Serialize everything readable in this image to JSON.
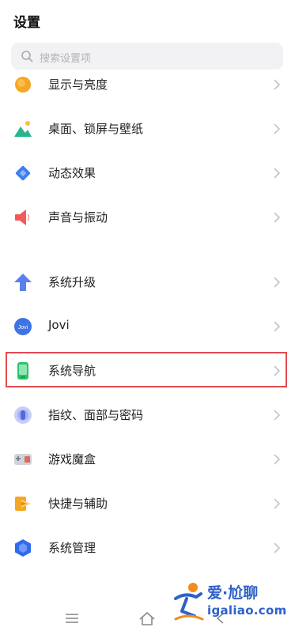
{
  "header": {
    "title": "设置"
  },
  "search": {
    "placeholder": "搜索设置项",
    "icon": "search-icon"
  },
  "items": [
    {
      "label": "显示与亮度",
      "icon": "display-brightness-icon"
    },
    {
      "label": "桌面、锁屏与壁纸",
      "icon": "wallpaper-icon"
    },
    {
      "label": "动态效果",
      "icon": "animation-effects-icon"
    },
    {
      "label": "声音与振动",
      "icon": "sound-vibration-icon"
    },
    {
      "label": "系统升级",
      "icon": "system-update-icon"
    },
    {
      "label": "Jovi",
      "icon": "jovi-icon",
      "icon_text": "Jovi"
    },
    {
      "label": "系统导航",
      "icon": "system-navigation-icon",
      "highlighted": true
    },
    {
      "label": "指纹、面部与密码",
      "icon": "fingerprint-icon"
    },
    {
      "label": "游戏魔盒",
      "icon": "game-box-icon"
    },
    {
      "label": "快捷与辅助",
      "icon": "shortcuts-accessibility-icon"
    },
    {
      "label": "系统管理",
      "icon": "system-management-icon"
    }
  ],
  "nav_bar": {
    "buttons": [
      "menu-icon",
      "home-icon",
      "back-icon"
    ]
  },
  "watermark": {
    "title": "爱·尬聊",
    "url": "igaliao.com"
  },
  "colors": {
    "highlight_border": "#e24a4f",
    "watermark": "#2e61c9",
    "search_bg": "#f2f2f4"
  }
}
